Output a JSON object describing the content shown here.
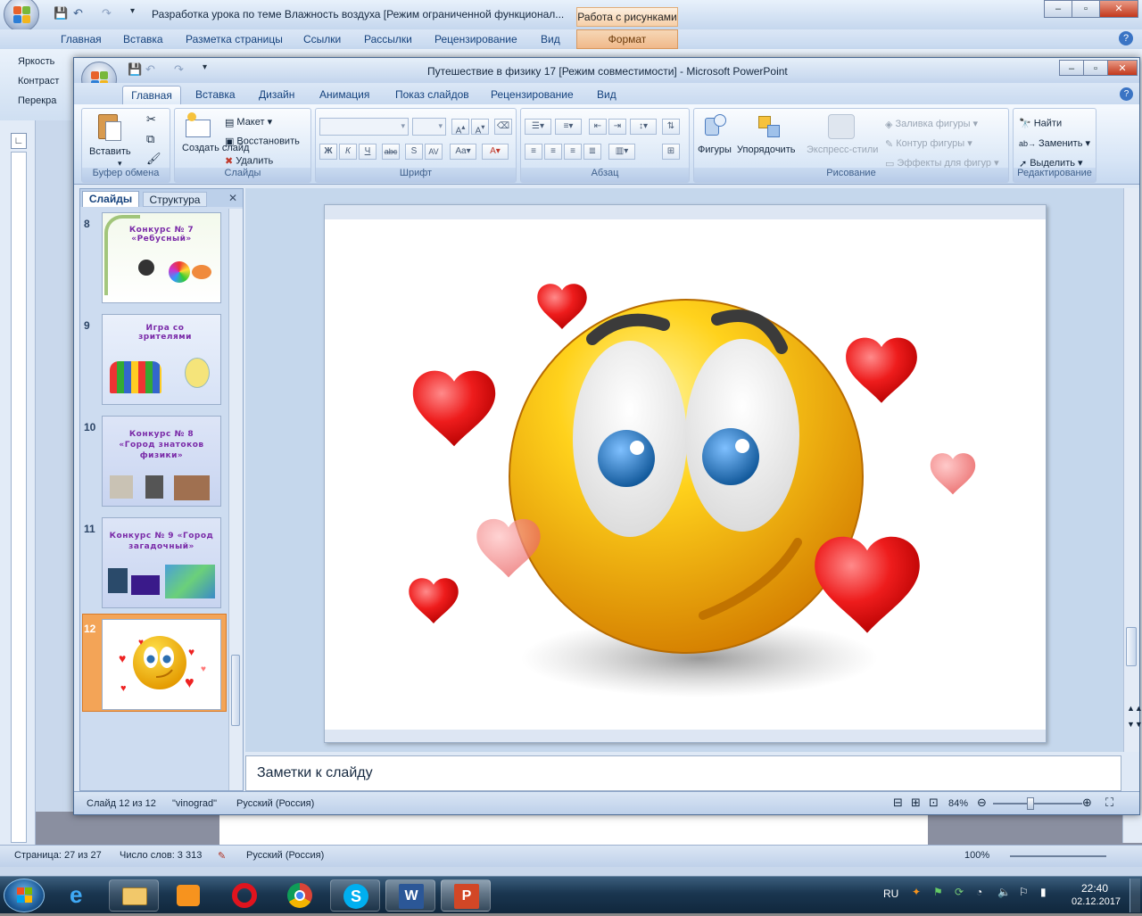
{
  "word": {
    "title": "Разработка урока по теме Влажность воздуха [Режим ограниченной функционал...",
    "picture_tools": "Работа с рисунками",
    "tabs": [
      "Главная",
      "Вставка",
      "Разметка страницы",
      "Ссылки",
      "Рассылки",
      "Рецензирование",
      "Вид"
    ],
    "format_tab": "Формат",
    "ribbon_items": [
      "Яркость",
      "Контраст",
      "Перекра"
    ],
    "status": {
      "page": "Страница: 27 из 27",
      "words": "Число слов: 3 313",
      "language": "Русский (Россия)",
      "zoom": "100%"
    }
  },
  "ppt": {
    "title": "Путешествие  в физику 17 [Режим совместимости] - Microsoft PowerPoint",
    "tabs": [
      "Главная",
      "Вставка",
      "Дизайн",
      "Анимация",
      "Показ слайдов",
      "Рецензирование",
      "Вид"
    ],
    "ribbon": {
      "clipboard": {
        "label": "Буфер обмена",
        "paste": "Вставить"
      },
      "slides": {
        "label": "Слайды",
        "new_slide": "Создать слайд",
        "layout": "Макет",
        "reset": "Восстановить",
        "delete": "Удалить"
      },
      "font": {
        "label": "Шрифт"
      },
      "paragraph": {
        "label": "Абзац"
      },
      "drawing": {
        "label": "Рисование",
        "shapes": "Фигуры",
        "arrange": "Упорядочить",
        "quick_styles": "Экспресс-стили",
        "fill": "Заливка фигуры",
        "outline": "Контур фигуры",
        "effects": "Эффекты для фигур"
      },
      "editing": {
        "label": "Редактирование",
        "find": "Найти",
        "replace": "Заменить",
        "select": "Выделить"
      }
    },
    "panel": {
      "tab_slides": "Слайды",
      "tab_outline": "Структура",
      "thumbs": [
        {
          "num": "8",
          "title": "Конкурс № 7 «Ребусный»"
        },
        {
          "num": "9",
          "title": "Игра со зрителями"
        },
        {
          "num": "10",
          "title": "Конкурс № 8 «Город знатоков физики»"
        },
        {
          "num": "11",
          "title": "Конкурс № 9 «Город загадочный»"
        },
        {
          "num": "12",
          "title": ""
        }
      ]
    },
    "notes_placeholder": "Заметки к слайду",
    "status": {
      "slide": "Слайд 12 из 12",
      "theme": "\"vinograd\"",
      "language": "Русский (Россия)",
      "zoom": "84%"
    }
  },
  "taskbar": {
    "lang": "RU",
    "time": "22:40",
    "date": "02.12.2017"
  }
}
